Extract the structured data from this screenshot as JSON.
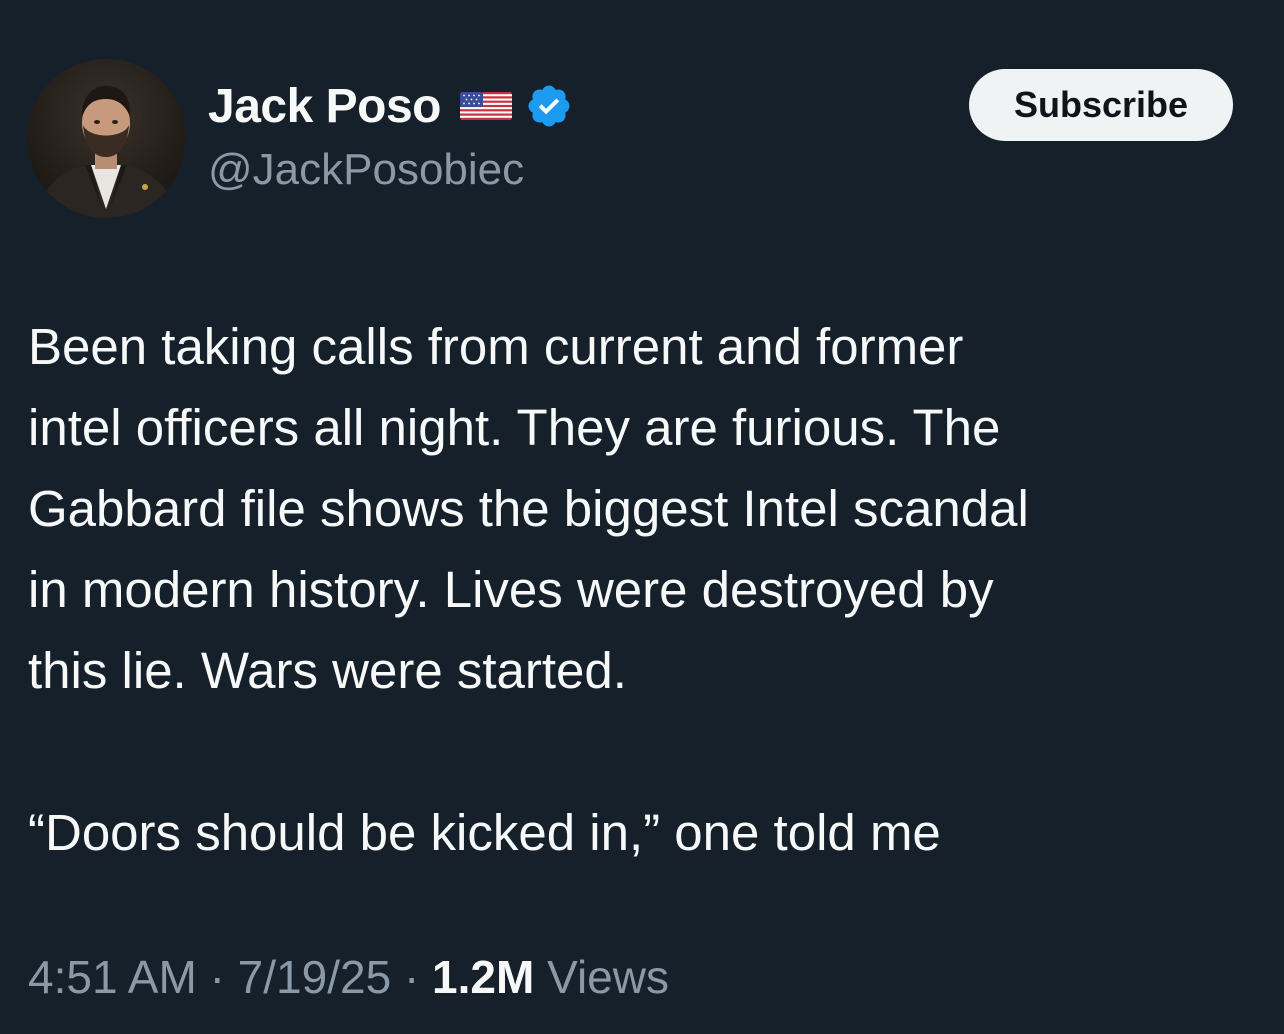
{
  "author": {
    "display_name": "Jack Poso",
    "handle": "@JackPosobiec",
    "flag_icon": "us-flag-icon",
    "verified_icon": "verified-badge-icon",
    "verified_color": "#1d9bf0"
  },
  "subscribe_label": "Subscribe",
  "tweet": {
    "lines": [
      "Been taking calls from current and former",
      "intel officers all night. They are furious. The",
      "Gabbard file shows the biggest Intel scandal",
      "in modern history. Lives were destroyed by",
      "this lie. Wars were started.",
      "“Doors should be kicked in,” one told me"
    ]
  },
  "meta": {
    "time": "4:51 AM",
    "separator": "·",
    "date": "7/19/25",
    "views_count": "1.2M",
    "views_label": "Views"
  },
  "colors": {
    "background": "#15202b",
    "primary_text": "#f7f9f9",
    "secondary_text": "#8b98a5",
    "button_bg": "#eff3f4"
  }
}
